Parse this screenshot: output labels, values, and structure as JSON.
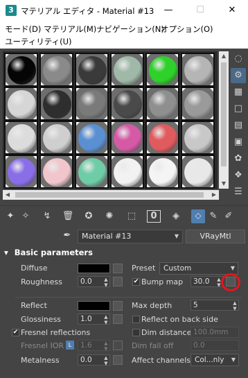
{
  "window": {
    "app_icon_glyph": "3",
    "title": "マテリアル エディタ - Material #13",
    "min_glyph": "—",
    "max_glyph": "☐",
    "close_glyph": "✕"
  },
  "menu": {
    "mode": "モード(D)",
    "material": "マテリアル(M)",
    "navigation": "ナビゲーション(N)",
    "options": "オプション(O)",
    "utilities": "ユーティリティ(U)"
  },
  "sample_slots": [
    {
      "color": "#050505",
      "style": "black"
    },
    {
      "color": "#8a8a8a",
      "style": "chrome"
    },
    {
      "color": "#3a3a3a",
      "style": "darkgloss"
    },
    {
      "color": "#9fb8a8",
      "style": "glass"
    },
    {
      "color": "#2ed02a",
      "style": "green"
    },
    {
      "color": "#b5b5b5",
      "style": "lightgrey"
    },
    {
      "color": "#d6d6d6",
      "style": "matte"
    },
    {
      "color": "#2e2e2e",
      "style": "dark"
    },
    {
      "color": "#7a7a7a",
      "style": "metal"
    },
    {
      "color": "#4a4a4a",
      "style": "darkmetal"
    },
    {
      "color": "#8f8f8f",
      "style": "grey"
    },
    {
      "color": "#9a9a9a",
      "style": "grey2"
    },
    {
      "color": "#dcdcdc",
      "style": "whitematte"
    },
    {
      "color": "#cfcfcf",
      "style": "clear"
    },
    {
      "color": "#5a8fd2",
      "style": "blue"
    },
    {
      "color": "#d45aa6",
      "style": "pink"
    },
    {
      "color": "#e05a5e",
      "style": "red"
    },
    {
      "color": "#c8c8c8",
      "style": "silver"
    },
    {
      "color": "#8a6ee8",
      "style": "purple"
    },
    {
      "color": "#f0c6cc",
      "style": "lightpink"
    },
    {
      "color": "#6ecca6",
      "style": "mint"
    },
    {
      "color": "#f2f2f2",
      "style": "white"
    },
    {
      "color": "#f4f4f4",
      "style": "white"
    },
    {
      "color": "#e8e8e8",
      "style": "white"
    }
  ],
  "scroll": {
    "up": "▲",
    "down": "▼",
    "left": "◀",
    "right": "▶"
  },
  "side_icons": [
    "◌",
    "⚙",
    "▦",
    "□",
    "▤",
    "▣",
    "✿",
    "❖",
    "☰"
  ],
  "toolbar_icons": [
    "✦",
    "✧",
    "↯",
    "🗑",
    "✪",
    "✺",
    "⬚",
    "0",
    "◈",
    "⬦",
    "✎",
    "✐"
  ],
  "material": {
    "eyedropper_glyph": "✒",
    "name": "Material #13",
    "type": "VRayMtl"
  },
  "rollout": {
    "collapse_glyph": "▾",
    "title": "Basic parameters",
    "diffuse_label": "Diffuse",
    "roughness_label": "Roughness",
    "roughness_value": "0.0",
    "preset_label": "Preset",
    "preset_value": "Custom",
    "bump_label": "Bump map",
    "bump_value": "30.0",
    "reflect_label": "Reflect",
    "glossiness_label": "Glossiness",
    "glossiness_value": "1.0",
    "fresnel_label": "Fresnel reflections",
    "fresnel_ior_label": "Fresnel IOR",
    "fresnel_lock_glyph": "L",
    "fresnel_ior_value": "1.6",
    "metalness_label": "Metalness",
    "metalness_value": "0.0",
    "max_depth_label": "Max depth",
    "max_depth_value": "5",
    "reflect_back_label": "Reflect on back side",
    "dim_distance_label": "Dim distance",
    "dim_distance_value": "100.0mm",
    "dim_falloff_label": "Dim fall off",
    "dim_falloff_value": "0.0",
    "affect_channels_label": "Affect channels",
    "affect_channels_value": "Col...nly",
    "check_glyph": "✔",
    "spin_glyph": "▲▼",
    "dd_glyph": "▼"
  },
  "colors": {
    "highlight_ring": "#e8141c",
    "accent": "#4f7fb0"
  }
}
